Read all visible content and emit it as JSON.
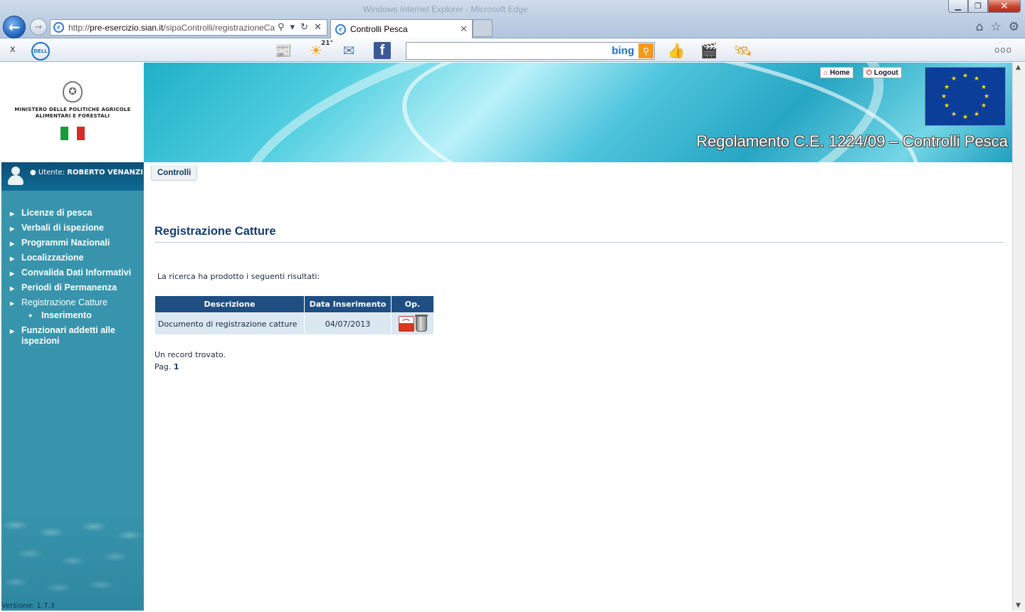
{
  "browser": {
    "window_title": "Windows Internet Explorer - Microsoft Edge",
    "url_prefix": "http://",
    "url_host": "pre-esercizio.sian.it",
    "url_path": "/sipaControlli/registrazioneCa",
    "tab_label": "Controlli Pesca",
    "toolbar": {
      "close": "x",
      "dell_logo": "DELL",
      "weather_temp": "21°",
      "search_placeholder": "",
      "search_brand": "bing",
      "more": "ooo"
    },
    "icons": [
      "back-icon",
      "forward-icon",
      "ie-icon",
      "search-icon",
      "refresh-icon",
      "stop-icon",
      "home-icon",
      "favorites-icon",
      "settings-icon"
    ]
  },
  "header": {
    "ministry": "MINISTERO DELLE POLITICHE AGRICOLE ALIMENTARI E FORESTALI",
    "banner_title": "Regolamento C.E. 1224/09 – Controlli Pesca",
    "home_label": "Home",
    "logout_label": "Logout"
  },
  "user": {
    "label": "Utente:",
    "name": "ROBERTO VENANZI"
  },
  "sidebar": {
    "items": [
      {
        "label": "Licenze di pesca"
      },
      {
        "label": "Verbali di ispezione"
      },
      {
        "label": "Programmi Nazionali"
      },
      {
        "label": "Localizzazione"
      },
      {
        "label": "Convalida Dati Informativi"
      },
      {
        "label": "Periodi di Permanenza"
      },
      {
        "label": "Registrazione Catture",
        "sub": [
          {
            "label": "Inserimento"
          }
        ]
      },
      {
        "label": "Funzionari addetti alle ispezioni"
      }
    ],
    "version": "Versione: 1.7.3"
  },
  "main": {
    "tab": "Controlli",
    "title": "Registrazione Catture",
    "result_message": "La ricerca ha prodotto i seguenti risultati:",
    "table": {
      "columns": [
        "Descrizione",
        "Data Inserimento",
        "Op."
      ],
      "rows": [
        {
          "descrizione": "Documento di registrazione catture",
          "data": "04/07/2013"
        }
      ]
    },
    "records_found": "Un record trovato.",
    "page_label": "Pag.",
    "page_number": "1"
  },
  "colors": {
    "sidebar_bg": "#3794ac",
    "table_header": "#1e4e82",
    "title_blue": "#123c70"
  }
}
